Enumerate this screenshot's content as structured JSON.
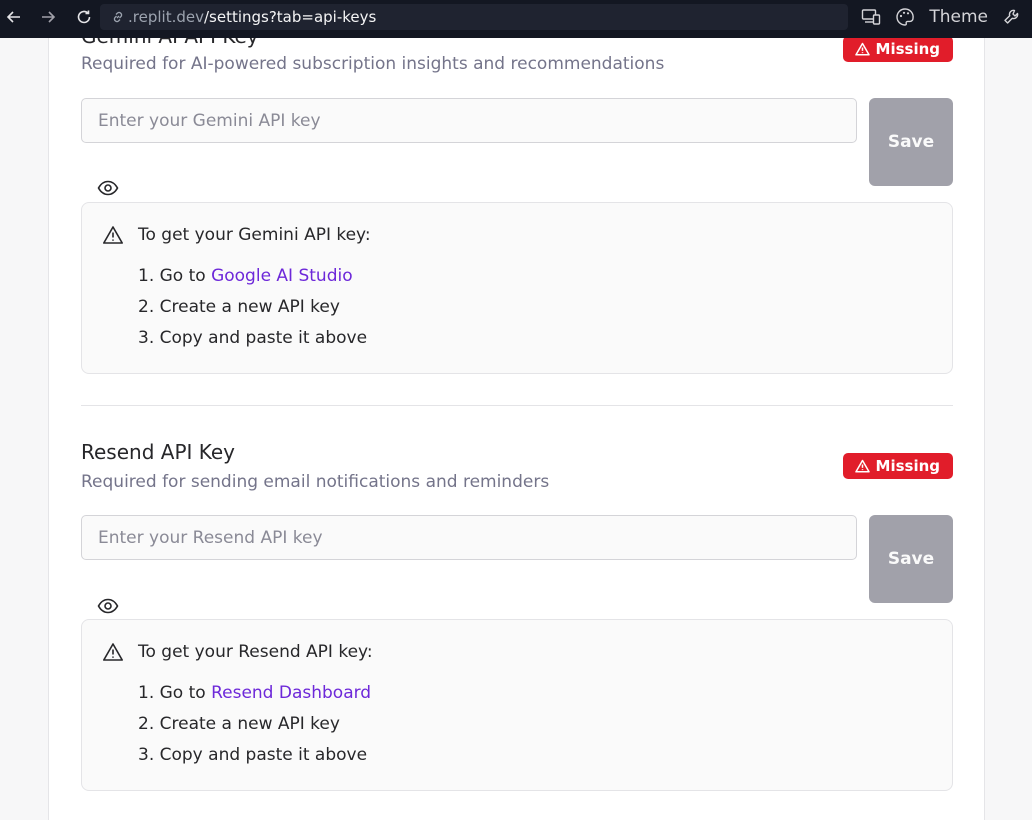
{
  "browser": {
    "url_host": ".replit.dev",
    "url_path": "/settings?tab=api-keys",
    "theme_label": "Theme"
  },
  "colors": {
    "badge": "#e11d2a",
    "link": "#6d28d9",
    "save_disabled": "#a1a1aa"
  },
  "sections": [
    {
      "title": "Gemini AI API Key",
      "description": "Required for AI-powered subscription insights and recommendations",
      "status": "Missing",
      "input_placeholder": "Enter your Gemini API key",
      "input_value": "",
      "save_label": "Save",
      "help_title": "To get your Gemini API key:",
      "steps": [
        {
          "prefix": "1. Go to ",
          "link": "Google AI Studio"
        },
        {
          "text": "2. Create a new API key"
        },
        {
          "text": "3. Copy and paste it above"
        }
      ]
    },
    {
      "title": "Resend API Key",
      "description": "Required for sending email notifications and reminders",
      "status": "Missing",
      "input_placeholder": "Enter your Resend API key",
      "input_value": "",
      "save_label": "Save",
      "help_title": "To get your Resend API key:",
      "steps": [
        {
          "prefix": "1. Go to ",
          "link": "Resend Dashboard"
        },
        {
          "text": "2. Create a new API key"
        },
        {
          "text": "3. Copy and paste it above"
        }
      ]
    }
  ]
}
